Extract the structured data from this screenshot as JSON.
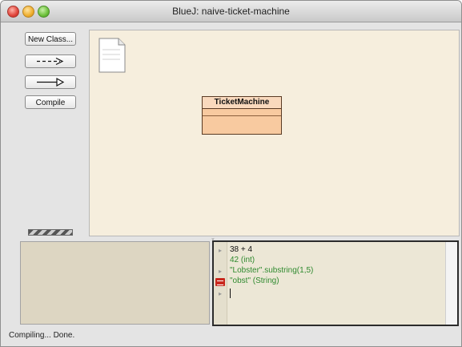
{
  "window": {
    "title": "BlueJ:  naive-ticket-machine"
  },
  "toolbar": {
    "new_class_label": "New Class...",
    "uses_arrow_icon": "dashed-arrow-icon",
    "inherits_arrow_icon": "hollow-arrow-icon",
    "compile_label": "Compile"
  },
  "diagram": {
    "readme_icon": "document-icon",
    "classes": [
      {
        "name": "TicketMachine"
      }
    ]
  },
  "codepad": {
    "lines": [
      {
        "text": "38 + 4",
        "kind": "input"
      },
      {
        "text": "42   (int)",
        "kind": "result"
      },
      {
        "text": "\"Lobster\".substring(1,5)",
        "kind": "input"
      },
      {
        "text": "\"obst\"   (String)",
        "kind": "object-result"
      }
    ]
  },
  "status": {
    "text": "Compiling... Done."
  },
  "colors": {
    "canvas_bg": "#f6eedd",
    "class_fill": "#f8caa0",
    "result_text": "#2f8a2f",
    "input_text": "#111111"
  }
}
